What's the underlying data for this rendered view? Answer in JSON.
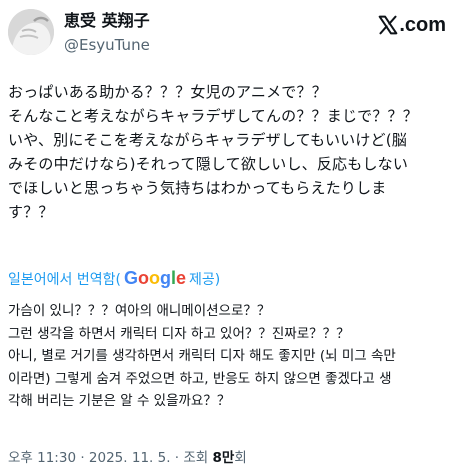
{
  "author": {
    "display_name": "恵受 英翔子",
    "handle": "@EsyuTune",
    "avatar_icon": "avatar-hand-photo"
  },
  "brand": {
    "logo_icon": "x-logo-icon",
    "logo_text": ".com"
  },
  "tweet": {
    "lines": [
      "おっぱいある助かる？？？女児のアニメで？？",
      "そんなこと考えながらキャラデザしてんの？？まじで？？？",
      "いや、別にそこを考えながらキャラデザしてもいいけど(脳",
      "みその中だけなら)それって隠して欲しいし、反応もしない",
      "でほしいと思っちゃう気持ちはわかってもらえたりしま",
      "す？？"
    ]
  },
  "translation": {
    "prefix": "일본어에서 번역함(",
    "google_letters": [
      {
        "char": "G",
        "color": "#4285F4"
      },
      {
        "char": "o",
        "color": "#EA4335"
      },
      {
        "char": "o",
        "color": "#FBBC05"
      },
      {
        "char": "g",
        "color": "#4285F4"
      },
      {
        "char": "l",
        "color": "#34A853"
      },
      {
        "char": "e",
        "color": "#EA4335"
      }
    ],
    "suffix": " 제공)",
    "lines": [
      "가슴이 있니？？？여아의 애니메이션으로？？",
      "그런 생각을 하면서 캐릭터 디자 하고 있어？？진짜로？？？",
      "아니, 별로 거기를 생각하면서 캐릭터 디자 해도 좋지만 (뇌 미그 속만",
      "이라면) 그렇게 숨겨 주었으면 하고, 반응도 하지 않으면 좋겠다고 생",
      "각해 버리는 기분은 알 수 있을까요？？"
    ]
  },
  "meta": {
    "timestamp": "오후 11:30 · 2025. 11. 5. · 조회 ",
    "views": "8만",
    "views_suffix": "회"
  },
  "colors": {
    "text": "#0f1419",
    "secondary": "#536471",
    "link": "#1d9bf0"
  }
}
